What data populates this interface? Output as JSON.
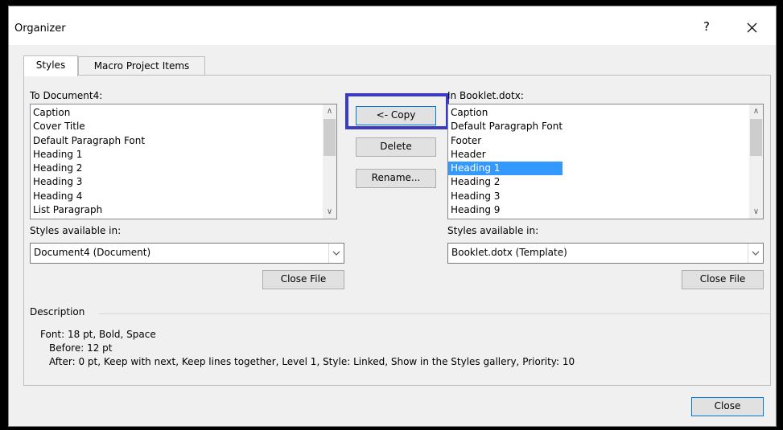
{
  "dialog": {
    "title": "Organizer",
    "help": "?"
  },
  "tabs": [
    {
      "label": "Styles"
    },
    {
      "label": "Macro Project Items"
    }
  ],
  "left": {
    "label": "To Document4:",
    "items": [
      "Caption",
      "Cover Title",
      "Default Paragraph Font",
      "Heading 1",
      "Heading 2",
      "Heading 3",
      "Heading 4",
      "List Paragraph"
    ],
    "available_label": "Styles available in:",
    "available_value": "Document4 (Document)",
    "close_file": "Close File"
  },
  "right": {
    "label": "In Booklet.dotx:",
    "items": [
      "Caption",
      "Default Paragraph Font",
      "Footer",
      "Header",
      "Heading 1",
      "Heading 2",
      "Heading 3",
      "Heading 9"
    ],
    "selected_index": 4,
    "available_label": "Styles available in:",
    "available_value": "Booklet.dotx (Template)",
    "close_file": "Close File"
  },
  "actions": {
    "copy": "<- Copy",
    "delete": "Delete",
    "rename": "Rename..."
  },
  "description": {
    "label": "Description",
    "lines": [
      "Font: 18 pt, Bold, Space",
      "Before:  12 pt",
      "After:  0 pt, Keep with next, Keep lines together, Level 1, Style: Linked, Show in the Styles gallery, Priority: 10"
    ]
  },
  "footer": {
    "close": "Close"
  },
  "colors": {
    "highlight": "#3b3bbf",
    "selection": "#3399ff",
    "focus": "#0078d7"
  }
}
